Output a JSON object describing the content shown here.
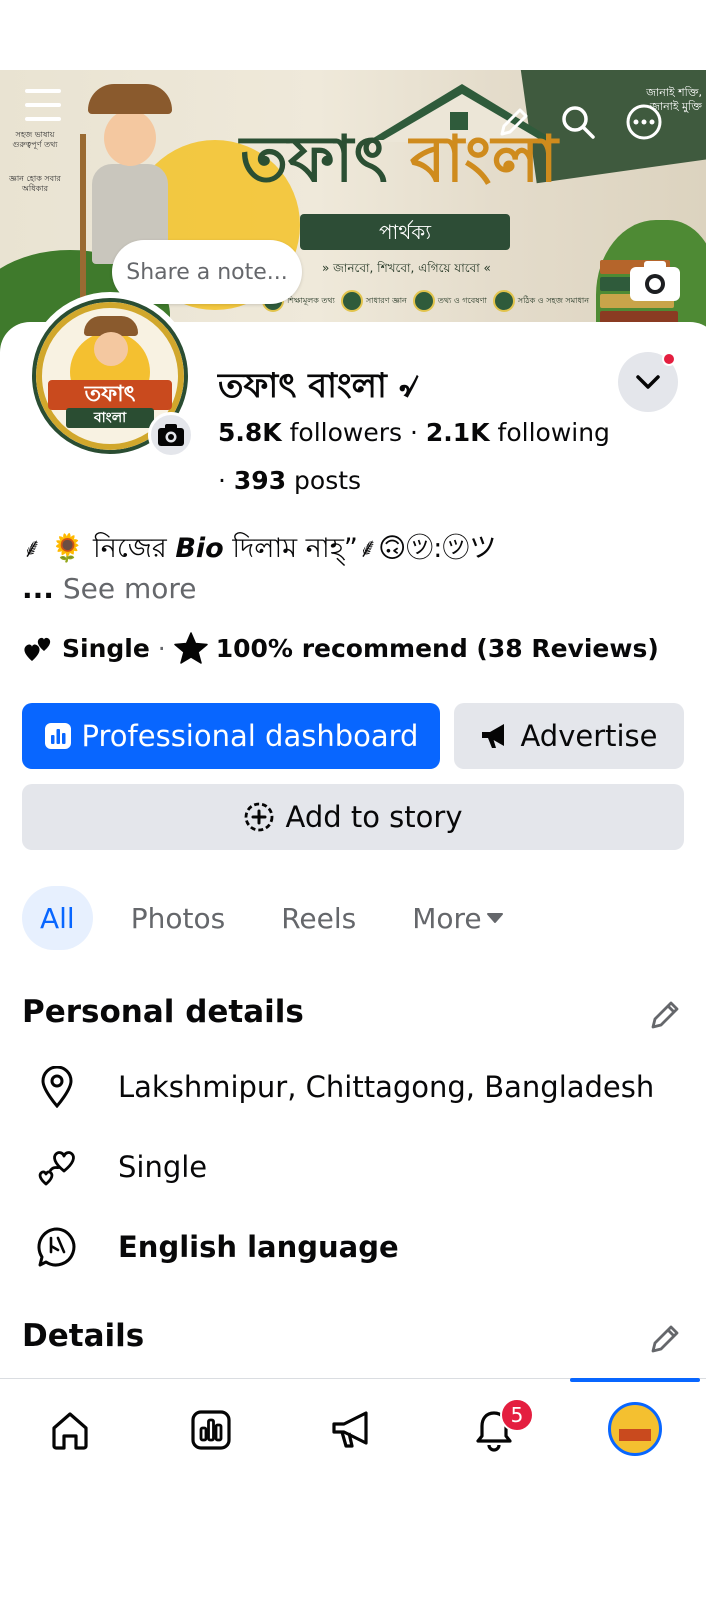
{
  "cover": {
    "title_part1": "তফাৎ",
    "title_part2": "বাংলা",
    "banner": "পার্থক্য",
    "tagline": "» জানবো, শিখবো, এগিয়ে যাবো «",
    "quote": "জানাই শক্তি, জানাই মুক্তি",
    "side_text_1": "সহজ ভাষায় গুরুত্বপূর্ণ তথ্য",
    "side_text_2": "জ্ঞান হোক সবার অধিকার",
    "chips": [
      "শিক্ষামূলক তথ্য",
      "সাধারণ জ্ঞান",
      "তথ্য ও গবেষণা",
      "সঠিক ও সহজ সমাধান"
    ]
  },
  "share_note": {
    "label": "Share a note..."
  },
  "profile": {
    "name": "তফাৎ বাংলা ৵",
    "avatar_label": "তফাৎ",
    "avatar_label2": "বাংলা",
    "followers_count": "5.8K",
    "followers_label": "followers",
    "following_count": "2.1K",
    "following_label": "following",
    "posts_count": "393",
    "posts_label": "posts",
    "bio_prefix": "⸙ 🌻 নিজের",
    "bio_bold": "Bio",
    "bio_suffix": "দিলাম নাহ্”⸙🙃㋡:㋡ツ",
    "see_more_prefix": "...",
    "see_more": "See more",
    "relationship": "Single",
    "recommend": "100% recommend (38 Reviews)"
  },
  "actions": {
    "professional_dashboard": "Professional dashboard",
    "advertise": "Advertise",
    "add_to_story": "Add to story"
  },
  "tabs": [
    {
      "label": "All",
      "active": true
    },
    {
      "label": "Photos",
      "active": false
    },
    {
      "label": "Reels",
      "active": false
    },
    {
      "label": "More",
      "active": false
    }
  ],
  "personal_details": {
    "title": "Personal details",
    "location": "Lakshmipur, Chittagong, Bangladesh",
    "relationship": "Single",
    "language": "English language"
  },
  "details": {
    "title": "Details"
  },
  "bottom_nav": {
    "items": [
      "home-icon",
      "dashboard-icon",
      "megaphone-icon",
      "bell-icon",
      "profile-avatar"
    ],
    "notification_badge": "5"
  },
  "colors": {
    "primary": "#0866ff",
    "secondary_bg": "#e4e6eb",
    "badge": "#e41e3f",
    "cover_green": "#2b4f33",
    "cover_gold": "#cf8b1d"
  }
}
